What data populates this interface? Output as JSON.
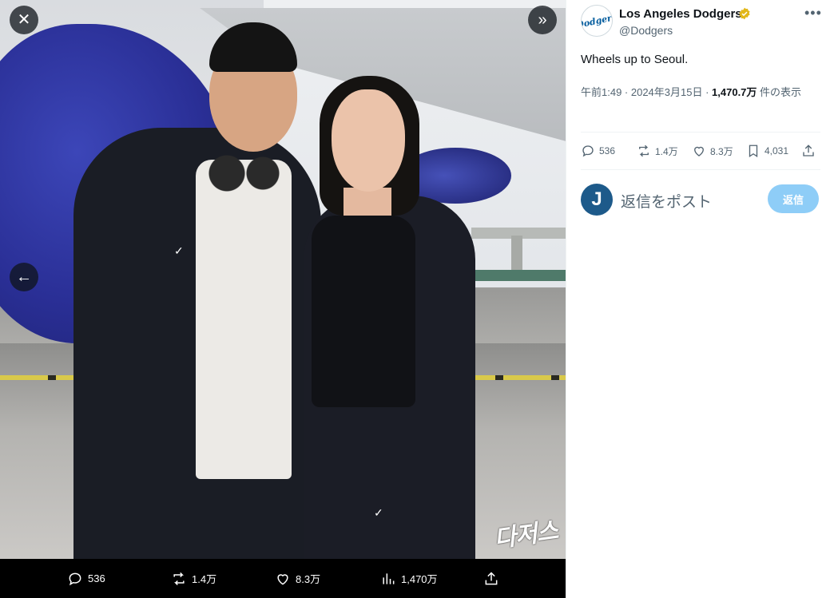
{
  "media_viewer": {
    "watermark": "다저스",
    "actions": {
      "replies": "536",
      "reposts": "1.4万",
      "likes": "8.3万",
      "views": "1,470万"
    }
  },
  "tweet": {
    "avatar_text": "Dodgers",
    "display_name": "Los Angeles Dodgers",
    "handle": "@Dodgers",
    "text": "Wheels up to Seoul.",
    "timestamp": "午前1:49 · 2024年3月15日 · ",
    "views_count": "1,470.7万",
    "views_suffix": " 件の表示",
    "stats": {
      "replies": "536",
      "reposts": "1.4万",
      "likes": "8.3万",
      "bookmarks": "4,031"
    }
  },
  "reply": {
    "avatar_letter": "J",
    "placeholder": "返信をポスト",
    "button_label": "返信"
  },
  "colors": {
    "verified_gold": "#e2b719",
    "reply_button": "#8ecdf7",
    "dodgers_blue": "#005a9c"
  }
}
